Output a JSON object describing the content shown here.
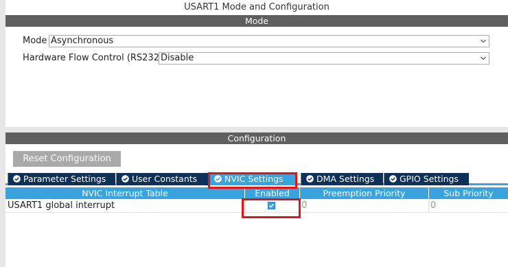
{
  "window": {
    "title": "USART1 Mode and Configuration"
  },
  "mode_section": {
    "header": "Mode",
    "fields": [
      {
        "label": "Mode",
        "value": "Asynchronous"
      },
      {
        "label": "Hardware Flow Control (RS232)",
        "value": "Disable"
      }
    ]
  },
  "config_section": {
    "header": "Configuration",
    "reset_label": "Reset Configuration",
    "tabs": [
      {
        "label": "Parameter Settings",
        "icon": "check-circle-icon"
      },
      {
        "label": "User Constants",
        "icon": "check-circle-icon"
      },
      {
        "label": "NVIC Settings",
        "icon": "check-circle-icon",
        "active": true
      },
      {
        "label": "DMA Settings",
        "icon": "check-circle-icon"
      },
      {
        "label": "GPIO Settings",
        "icon": "check-circle-icon"
      }
    ],
    "nvic_table": {
      "columns": [
        "NVIC Interrupt Table",
        "Enabled",
        "Preemption Priority",
        "Sub Priority"
      ],
      "rows": [
        {
          "name": "USART1 global interrupt",
          "enabled": true,
          "preemption": "0",
          "sub": "0"
        }
      ]
    }
  },
  "colors": {
    "section_header_bg": "#5f5f5f",
    "tab_bg": "#0f3057",
    "accent": "#39a3dc",
    "highlight": "#e0141b"
  }
}
